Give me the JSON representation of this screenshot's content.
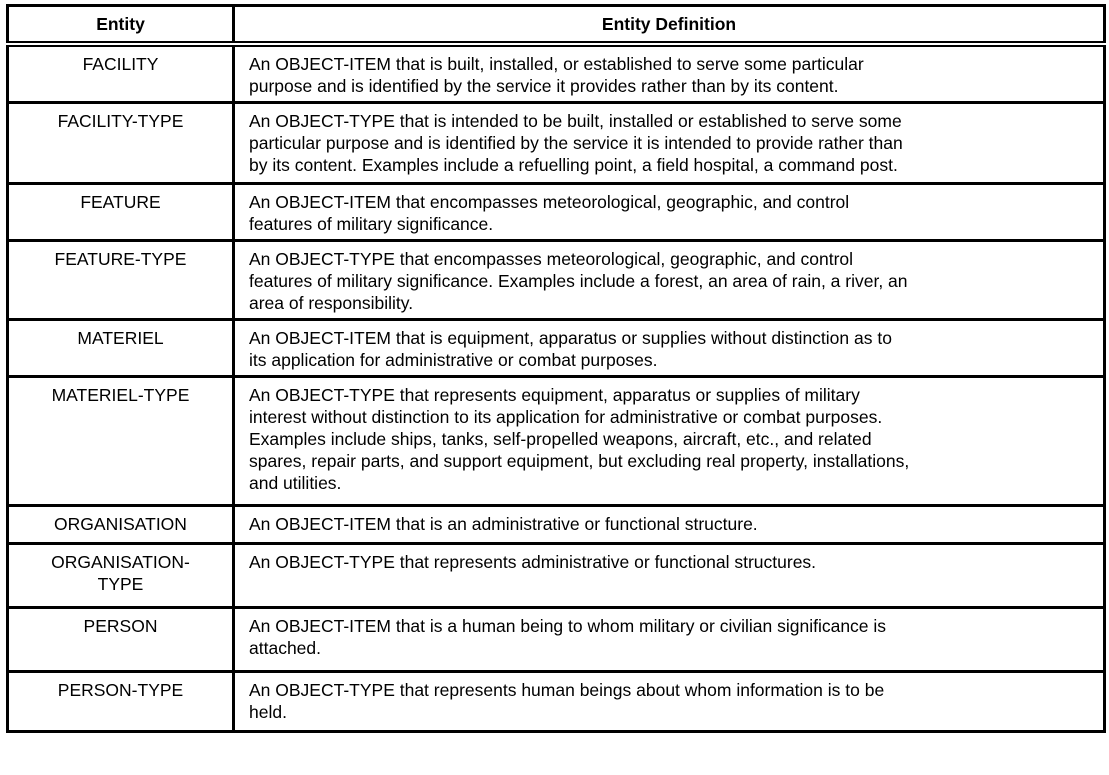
{
  "table": {
    "headers": [
      "Entity",
      "Entity Definition"
    ],
    "rows": [
      {
        "entity": [
          "FACILITY"
        ],
        "definition": [
          "An OBJECT-ITEM that is built, installed, or established to serve some particular",
          "purpose and is identified by the service it provides rather than by its content."
        ]
      },
      {
        "entity": [
          "FACILITY-TYPE"
        ],
        "definition": [
          "An OBJECT-TYPE that is intended to be built, installed or established to serve some",
          "particular purpose and is identified by the service it is intended to provide rather than",
          "by its content. Examples include a refuelling point, a field hospital, a command post."
        ]
      },
      {
        "entity": [
          "FEATURE"
        ],
        "definition": [
          "An OBJECT-ITEM that encompasses meteorological, geographic, and control",
          "features of military significance."
        ]
      },
      {
        "entity": [
          "FEATURE-TYPE"
        ],
        "definition": [
          "An OBJECT-TYPE that encompasses meteorological, geographic, and control",
          "features of military significance. Examples include a forest, an area of rain, a river, an",
          "area of responsibility."
        ]
      },
      {
        "entity": [
          "MATERIEL"
        ],
        "definition": [
          "An OBJECT-ITEM that is equipment, apparatus or supplies without distinction as to",
          "its application for administrative or combat purposes."
        ]
      },
      {
        "entity": [
          "MATERIEL-TYPE"
        ],
        "definition": [
          "An OBJECT-TYPE that represents equipment, apparatus or supplies of military",
          "interest without distinction to its application for administrative or combat purposes.",
          "Examples include ships, tanks, self-propelled weapons, aircraft, etc., and related",
          "spares, repair parts, and support equipment, but excluding real property, installations,",
          "and utilities."
        ]
      },
      {
        "entity": [
          "ORGANISATION"
        ],
        "definition": [
          "An OBJECT-ITEM that is an administrative or functional structure."
        ]
      },
      {
        "entity": [
          "ORGANISATION-",
          "TYPE"
        ],
        "definition": [
          "An OBJECT-TYPE that represents administrative or functional structures."
        ]
      },
      {
        "entity": [
          "PERSON"
        ],
        "definition": [
          "An OBJECT-ITEM that is a human being to whom military or civilian significance is",
          "attached."
        ]
      },
      {
        "entity": [
          "PERSON-TYPE"
        ],
        "definition": [
          "An OBJECT-TYPE that represents human beings about whom information is to be",
          "held."
        ]
      }
    ]
  }
}
